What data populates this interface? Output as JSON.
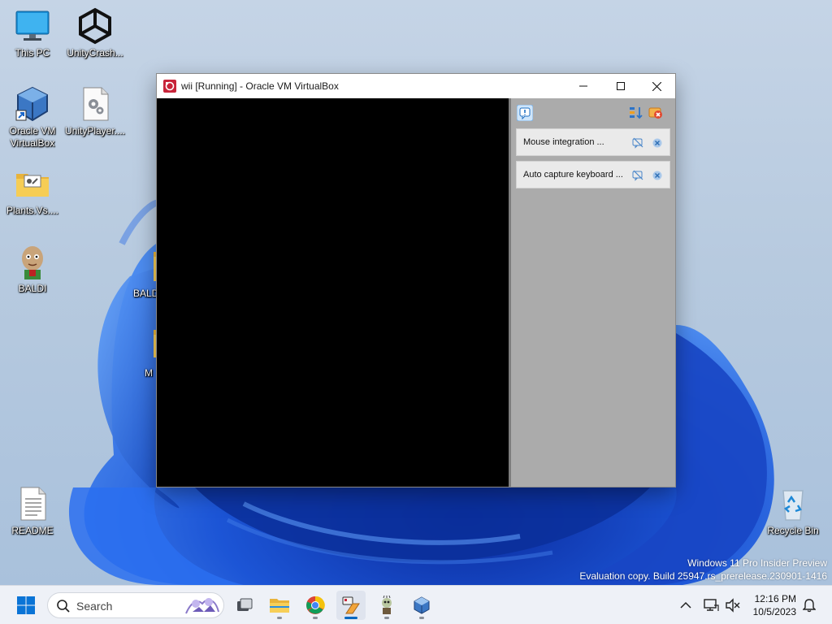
{
  "desktop": {
    "icons": [
      {
        "label": "This PC",
        "icon": "monitor-icon"
      },
      {
        "label": "UnityCrash...",
        "icon": "unity-icon"
      },
      {
        "label": "Oracle VM VirtualBox",
        "line1": "Oracle VM",
        "line2": "VirtualBox",
        "icon": "virtualbox-icon"
      },
      {
        "label": "UnityPlayer....",
        "icon": "settings-file-icon"
      },
      {
        "label": "Plants.Vs....",
        "icon": "folder-icon"
      },
      {
        "label": "BALDI",
        "icon": "baldi-icon"
      },
      {
        "label": "BALD",
        "icon": "folder-icon"
      },
      {
        "label": "M",
        "icon": "folder-icon"
      },
      {
        "label": "README",
        "icon": "text-file-icon"
      },
      {
        "label": "Recycle Bin",
        "icon": "recycle-bin-icon"
      }
    ],
    "watermark": {
      "line1": "Windows 11 Pro Insider Preview",
      "line2": "Evaluation copy. Build 25947.rs_prerelease.230901-1416"
    }
  },
  "window": {
    "title": "wii [Running] - Oracle VM VirtualBox",
    "notifications": [
      {
        "text": "Mouse integration ..."
      },
      {
        "text": "Auto capture keyboard ..."
      }
    ]
  },
  "taskbar": {
    "search_placeholder": "Search",
    "time": "12:16 PM",
    "date": "10/5/2023"
  },
  "colors": {
    "accent": "#0067c0",
    "wallpaper_blue": "#1f5bd8",
    "panel_gray": "#ababab"
  }
}
